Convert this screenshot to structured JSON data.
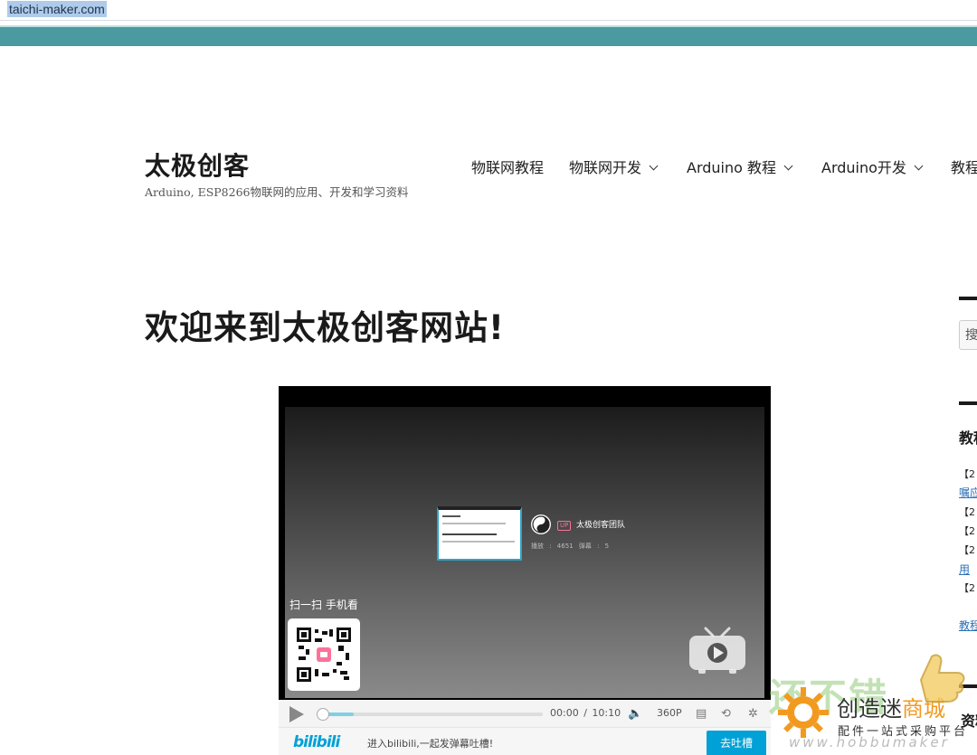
{
  "browser": {
    "url": "taichi-maker.com"
  },
  "colors": {
    "topbar": "#4a9aa0",
    "bilibili_blue": "#00a1d6",
    "bilibili_pink": "#fb7299"
  },
  "header": {
    "site_title": "太极创客",
    "site_description": "Arduino, ESP8266物联网的应用、开发和学习资料"
  },
  "nav": {
    "items": [
      {
        "label": "物联网教程",
        "has_dropdown": false
      },
      {
        "label": "物联网开发",
        "has_dropdown": true
      },
      {
        "label": "Arduino 教程",
        "has_dropdown": true
      },
      {
        "label": "Arduino开发",
        "has_dropdown": true
      },
      {
        "label": "教程",
        "has_dropdown": false
      }
    ]
  },
  "main": {
    "page_title": "欢迎来到太极创客网站!"
  },
  "video": {
    "uploader_badge": "UP",
    "uploader_name": "太极创客团队",
    "stats": "播放 : 4651   弹幕 : 5",
    "scan_text": "扫一扫 手机看",
    "current_time": "00:00",
    "separator": "/",
    "duration": "10:10",
    "quality": "360P",
    "progress": 0.15,
    "logo": "bilibili",
    "danmaku_prompt": "进入bilibili,一起发弹幕吐槽!",
    "send_button": "去吐槽"
  },
  "sidebar": {
    "search_placeholder": "搜",
    "heading_1": "教程",
    "lines": [
      "【2",
      "【2",
      "【2",
      "【2",
      "【2"
    ],
    "links": [
      "嘱应",
      "用",
      "教程"
    ],
    "heading_2": "资料"
  },
  "watermark": {
    "big_text": "还不错",
    "brand_prefix": "创造迷",
    "brand_suffix": "商城",
    "tagline": "配件一站式采购平台",
    "url": "www.hobbumaker"
  }
}
